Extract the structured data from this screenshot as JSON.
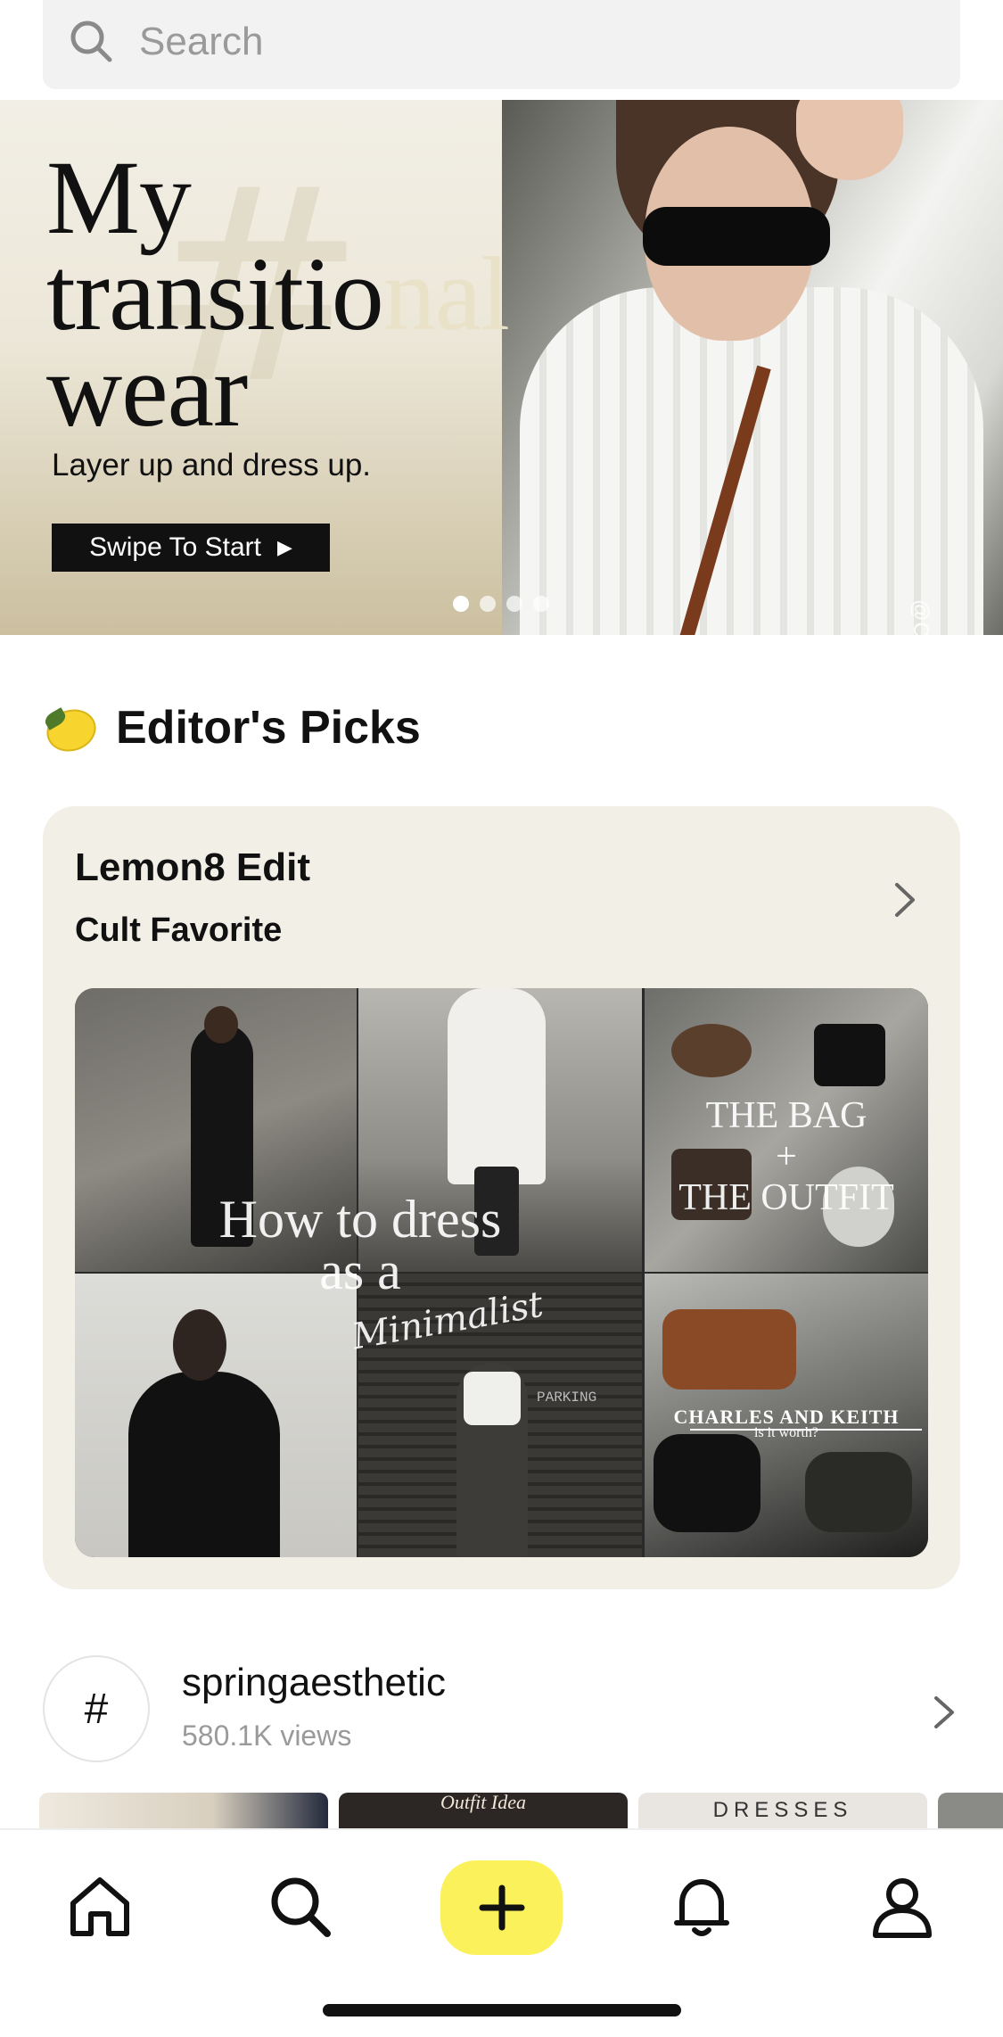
{
  "search": {
    "placeholder": "Search"
  },
  "banner": {
    "title_line1": "My",
    "title_line2_dark": "transitio",
    "title_line2_light": "nal",
    "title_line3": "wear",
    "subtitle": "Layer up and dress up.",
    "button_label": "Swipe To Start",
    "button_icon": "play-triangle-icon",
    "photo_credit": "@Clara Serrada",
    "pagination": {
      "total": 4,
      "active_index": 0
    }
  },
  "editors_picks": {
    "icon": "lemon-icon",
    "title": "Editor's Picks",
    "card": {
      "title": "Lemon8 Edit",
      "subtitle": "Cult Favorite",
      "collage": {
        "main_text": "How to dress as a",
        "script_text": "Minimalist",
        "bag_text_line1": "THE BAG",
        "bag_text_line2": "+",
        "bag_text_line3": "THE OUTFIT",
        "ck_text": "CHARLES AND KEITH",
        "ck_subtext": "is it worth?",
        "sign_text": "PARKING"
      }
    }
  },
  "hashtag": {
    "symbol": "#",
    "name": "springaesthetic",
    "views": "580.1K views",
    "thumbnails": [
      {
        "text": ""
      },
      {
        "text": "Outfit Idea"
      },
      {
        "text": "DRESSES"
      },
      {
        "text": ""
      }
    ]
  },
  "bottom_nav": {
    "items": [
      {
        "icon": "home-icon"
      },
      {
        "icon": "search-icon"
      },
      {
        "icon": "plus-icon"
      },
      {
        "icon": "bell-icon"
      },
      {
        "icon": "profile-icon"
      }
    ],
    "add_button_color": "#fbf15b"
  },
  "colors": {
    "accent_yellow": "#fbf15b",
    "card_bg": "#f2efe7",
    "search_bg": "#f2f2f2"
  }
}
